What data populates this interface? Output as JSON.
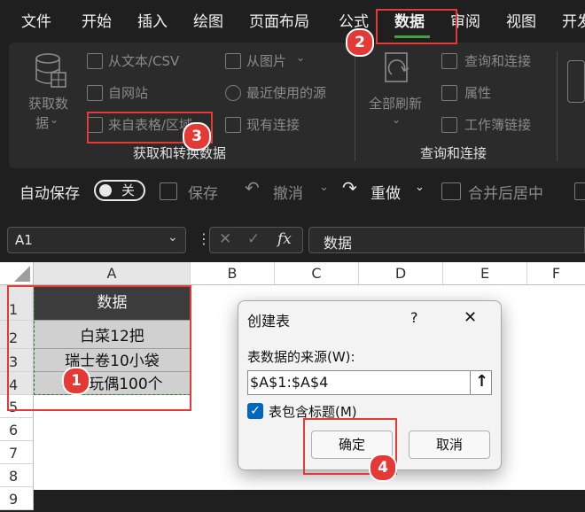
{
  "tabs": [
    "文件",
    "开始",
    "插入",
    "绘图",
    "页面布局",
    "公式",
    "数据",
    "审阅",
    "视图",
    "开发"
  ],
  "ribbon": {
    "get_data_label": "获取数",
    "get_data_label2": "据",
    "from_text_csv": "从文本/CSV",
    "from_web": "自网站",
    "from_table_range": "来自表格/区域",
    "from_picture": "从图片",
    "recent_sources": "最近使用的源",
    "existing_connections": "现有连接",
    "group_get_transform": "获取和转换数据",
    "refresh_all": "全部刷新",
    "queries_connections": "查询和连接",
    "properties": "属性",
    "workbook_links": "工作簿链接",
    "group_queries": "查询和连接"
  },
  "qat": {
    "autosave": "自动保存",
    "toggle_state": "关",
    "save": "保存",
    "undo": "撤消",
    "redo": "重做",
    "merge_center": "合并后居中"
  },
  "formula_bar": {
    "name_box": "A1",
    "fx": "fx",
    "value": "数据"
  },
  "sheet": {
    "columns": [
      "A",
      "B",
      "C",
      "D",
      "E",
      "F"
    ],
    "rows": [
      "1",
      "2",
      "3",
      "4",
      "5",
      "6",
      "7",
      "8",
      "9"
    ],
    "cells": [
      "数据",
      "白菜12把",
      "瑞士卷10小袋",
      "eva玩偶100个"
    ]
  },
  "dialog": {
    "title": "创建表",
    "help": "?",
    "close": "✕",
    "source_label": "表数据的来源(W):",
    "range_value": "$A$1:$A$4",
    "has_headers_label": "表包含标题(M)",
    "has_headers_checked": true,
    "ok": "确定",
    "cancel": "取消"
  },
  "annotations": [
    "1",
    "2",
    "3",
    "4"
  ],
  "colors": {
    "accent_green": "#43a047",
    "annotation_red": "#e53935",
    "checkbox_blue": "#0067c0"
  }
}
